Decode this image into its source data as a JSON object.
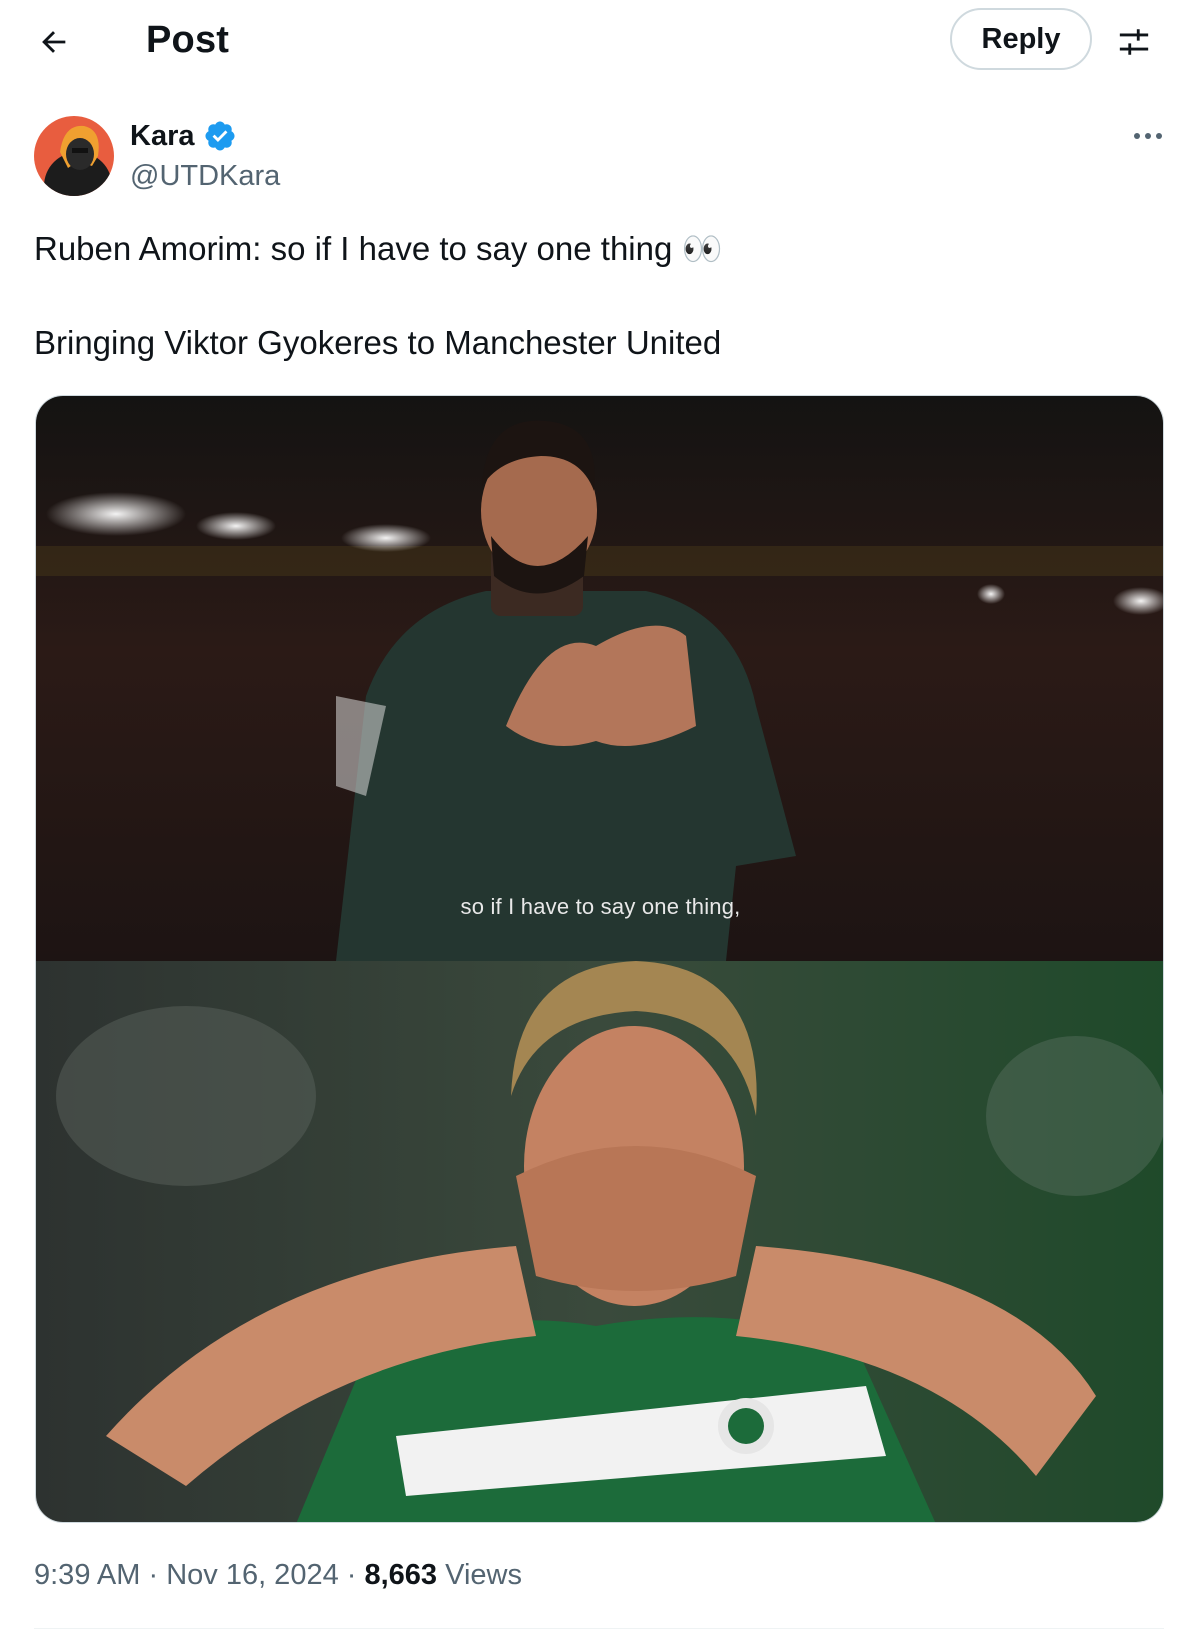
{
  "header": {
    "title": "Post",
    "reply_label": "Reply",
    "back_icon": "arrow-left-icon",
    "settings_icon": "sliders-icon"
  },
  "tweet": {
    "author_name": "Kara",
    "author_handle": "@UTDKara",
    "verified": true,
    "text_line1": "Ruben Amorim: so if I have to say one thing 👀",
    "text_line2": "Bringing Viktor Gyokeres to Manchester United",
    "media_caption": "so if I have to say one thing,",
    "time": "9:39 AM",
    "separator": " · ",
    "date": "Nov 16, 2024",
    "views_count": "8,663",
    "views_label": "Views"
  },
  "colors": {
    "text_primary": "#0f1419",
    "text_secondary": "#536471",
    "verified_blue": "#1d9bf0",
    "border": "#cfd9de"
  }
}
